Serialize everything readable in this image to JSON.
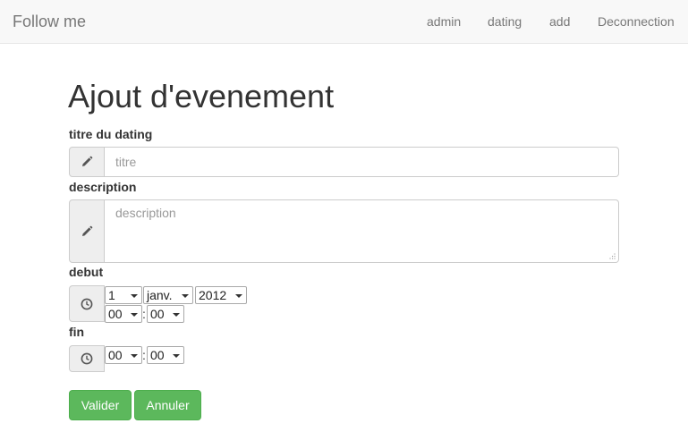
{
  "navbar": {
    "brand": "Follow me",
    "links": [
      "admin",
      "dating",
      "add",
      "Deconnection"
    ]
  },
  "page": {
    "title": "Ajout d'evenement"
  },
  "form": {
    "titre": {
      "label": "titre du dating",
      "placeholder": "titre",
      "icon": "pencil-icon"
    },
    "description": {
      "label": "description",
      "placeholder": "description",
      "icon": "pencil-icon"
    },
    "debut": {
      "label": "debut",
      "icon": "clock-icon",
      "day": "1",
      "month": "janv.",
      "year": "2012",
      "hour": "00",
      "minute": "00",
      "separator": ":"
    },
    "fin": {
      "label": "fin",
      "icon": "clock-icon",
      "hour": "00",
      "minute": "00",
      "separator": ":"
    }
  },
  "buttons": {
    "submit": "Valider",
    "cancel": "Annuler"
  },
  "colors": {
    "navbar_bg": "#f8f8f8",
    "success": "#5cb85c",
    "addon_bg": "#eeeeee"
  }
}
